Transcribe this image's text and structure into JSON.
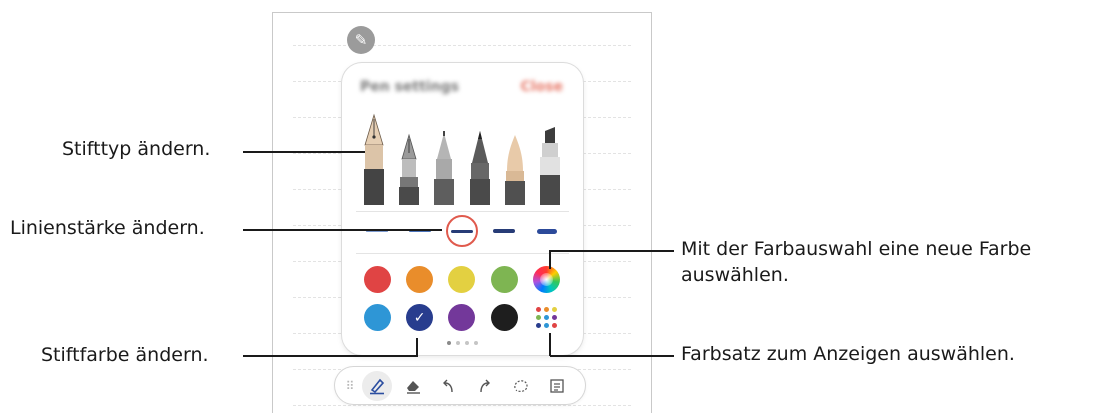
{
  "panel": {
    "title": "Pen settings",
    "close_label": "Close"
  },
  "pen_types": [
    {
      "name": "Fountain pen",
      "body": "#444444",
      "nib": "#e6cfb4"
    },
    {
      "name": "Calligraphy pen",
      "body": "#555555",
      "nib": "#8f8f8f"
    },
    {
      "name": "Pen",
      "body": "#5e5e5e",
      "nib": "#a9a9a9"
    },
    {
      "name": "Pencil",
      "body": "#4a4a4a",
      "nib": "#4e4e4e"
    },
    {
      "name": "Brush",
      "body": "#505050",
      "nib": "#e8caa9"
    },
    {
      "name": "Highlighter",
      "body": "#494949",
      "nib": "#cfcfcf"
    }
  ],
  "line_widths": [
    "thinnest",
    "thin",
    "medium",
    "thick",
    "thickest"
  ],
  "selected_width_index": 2,
  "colors": [
    {
      "name": "red",
      "hex": "#e04444"
    },
    {
      "name": "orange",
      "hex": "#e98d2b"
    },
    {
      "name": "yellow",
      "hex": "#e3d041"
    },
    {
      "name": "green",
      "hex": "#7eb552"
    },
    {
      "name": "color-picker",
      "hex": "wheel"
    },
    {
      "name": "blue",
      "hex": "#2e96d6"
    },
    {
      "name": "navy",
      "hex": "#283d8e"
    },
    {
      "name": "purple",
      "hex": "#73389a"
    },
    {
      "name": "black",
      "hex": "#1e1e1e"
    },
    {
      "name": "palette",
      "hex": "palette"
    }
  ],
  "selected_color": "navy",
  "palette_dots": [
    "#e04444",
    "#e98d2b",
    "#e3d041",
    "#7eb552",
    "#2e96d6",
    "#73389a",
    "#283d8e",
    "#2e96d6",
    "#e04444"
  ],
  "page_indicator": {
    "count": 4,
    "active": 0
  },
  "toolbar": {
    "handle_icon": "drag-handle-icon",
    "items": [
      "pen-icon",
      "eraser-icon",
      "undo-icon",
      "redo-icon",
      "lasso-icon",
      "insert-icon"
    ]
  },
  "callouts": {
    "pen_type": "Stifttyp ändern.",
    "line_width": "Linienstärke ändern.",
    "pen_color": "Stiftfarbe ändern.",
    "color_picker_line1": "Mit der Farbauswahl eine neue Farbe",
    "color_picker_line2": "auswählen.",
    "palette": "Farbsatz zum Anzeigen auswählen."
  }
}
